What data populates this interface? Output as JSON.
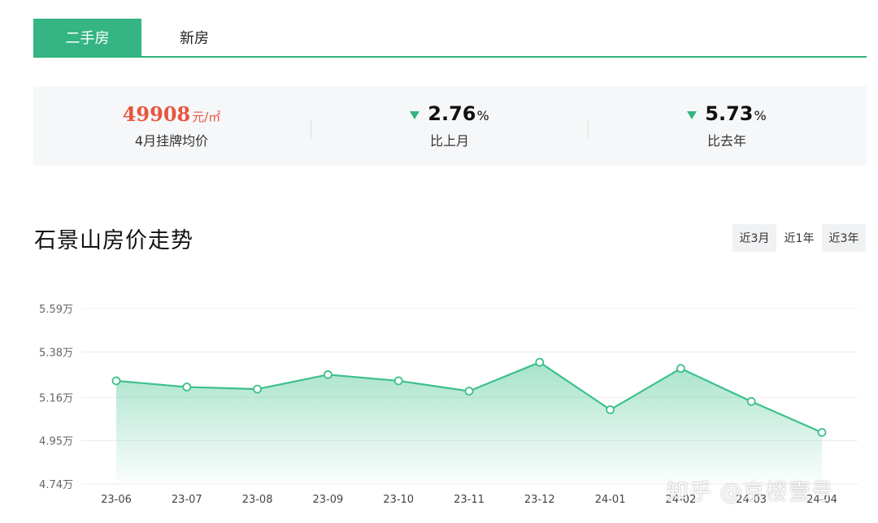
{
  "tabs": {
    "secondhand": "二手房",
    "newhome": "新房"
  },
  "stats": {
    "price": {
      "value": "49908",
      "unit": "元/㎡",
      "label": "4月挂牌均价"
    },
    "month": {
      "value": "2.76",
      "sign": "%",
      "label": "比上月",
      "direction": "down"
    },
    "year": {
      "value": "5.73",
      "sign": "%",
      "label": "比去年",
      "direction": "down"
    }
  },
  "section": {
    "title": "石景山房价走势",
    "ranges": [
      "近3月",
      "近1年",
      "近3年"
    ],
    "active_range": "近1年"
  },
  "colors": {
    "accent": "#34b583",
    "price": "#e8553e",
    "line": "#3cc08c"
  },
  "chart_data": {
    "type": "area",
    "x": [
      "23-06",
      "23-07",
      "23-08",
      "23-09",
      "23-10",
      "23-11",
      "23-12",
      "24-01",
      "24-02",
      "24-03",
      "24-04"
    ],
    "values": [
      5.24,
      5.21,
      5.2,
      5.27,
      5.24,
      5.19,
      5.33,
      5.1,
      5.3,
      5.14,
      4.99
    ],
    "yticks": [
      4.74,
      4.95,
      5.16,
      5.38,
      5.59
    ],
    "ytick_labels": [
      "4.74万",
      "4.95万",
      "5.16万",
      "5.38万",
      "5.59万"
    ],
    "ylim": [
      4.74,
      5.59
    ],
    "grid": true,
    "legend": "none"
  },
  "watermark": "知乎 @京楼壹号"
}
